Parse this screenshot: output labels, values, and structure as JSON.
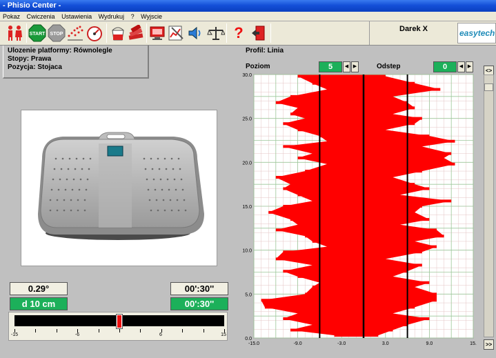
{
  "window": {
    "title": "- Phisio Center -"
  },
  "menu": [
    "Pokaz",
    "Cwiczenia",
    "Ustawienia",
    "Wydrukuj",
    "?",
    "Wyjscie"
  ],
  "toolbar": {
    "buttons": [
      {
        "name": "patients-icon"
      },
      {
        "name": "start-icon",
        "label": "START"
      },
      {
        "name": "stop-icon",
        "label": "STOP"
      },
      {
        "name": "sparkle-icon"
      },
      {
        "name": "gauge-icon"
      },
      {
        "name": "bucket-icon"
      },
      {
        "name": "books-icon"
      },
      {
        "name": "monitor-icon"
      },
      {
        "name": "chart-edit-icon"
      },
      {
        "name": "speaker-icon"
      },
      {
        "name": "balance-icon"
      },
      {
        "name": "help-icon",
        "label": "?"
      },
      {
        "name": "exit-icon"
      }
    ],
    "user": "Darek X",
    "logo": "easytech"
  },
  "info": {
    "line1": "Ulozenie platformy: Równolegle",
    "line2": "Stopy: Prawa",
    "line3": "Pozycja: Stojaca"
  },
  "readouts": {
    "angle": "0.29°",
    "time1": "00':30''",
    "distance": "d 10 cm",
    "time2": "00':30''"
  },
  "slider": {
    "min": -15,
    "max": 15,
    "value": 0,
    "tick_labels": [
      "-15",
      "-6",
      "6",
      "15"
    ]
  },
  "profile": {
    "label": "Profil: Linia",
    "poziom_label": "Poziom",
    "poziom_value": "5",
    "odstep_label": "Odstep",
    "odstep_value": "0"
  },
  "side_buttons": {
    "top": "<>",
    "bottom": ">>"
  },
  "colors": {
    "trace": "#ff0000",
    "green": "#1cb05a",
    "grid": "#b9dcb4"
  },
  "chart_data": {
    "type": "area",
    "x_ticks": [
      "-15.0",
      "-9.0",
      "-3.0",
      "3.0",
      "9.0",
      "15."
    ],
    "y_ticks": [
      "0.0",
      "5.0",
      "10.0",
      "15.0",
      "20.0",
      "25.0",
      "30.0"
    ],
    "xlim": [
      -15,
      15
    ],
    "ylim": [
      0,
      30
    ],
    "center_line": 0,
    "guide_lines": [
      -6,
      6
    ],
    "trace": [
      {
        "y": 29.8,
        "left": -9,
        "right": 3
      },
      {
        "y": 29.0,
        "left": -7,
        "right": 7
      },
      {
        "y": 28.3,
        "left": -5,
        "right": 10.5
      },
      {
        "y": 27.5,
        "left": -10,
        "right": 4
      },
      {
        "y": 26.8,
        "left": -12,
        "right": 6
      },
      {
        "y": 26.2,
        "left": -9,
        "right": 7
      },
      {
        "y": 25.5,
        "left": -10,
        "right": 4
      },
      {
        "y": 25.0,
        "left": -8,
        "right": 8
      },
      {
        "y": 24.4,
        "left": -11,
        "right": 7
      },
      {
        "y": 23.7,
        "left": -9,
        "right": 3
      },
      {
        "y": 23.0,
        "left": -6,
        "right": 9
      },
      {
        "y": 22.4,
        "left": -5,
        "right": 12.5
      },
      {
        "y": 21.8,
        "left": -11,
        "right": 8
      },
      {
        "y": 21.0,
        "left": -7,
        "right": 12
      },
      {
        "y": 20.5,
        "left": -9,
        "right": 11
      },
      {
        "y": 19.8,
        "left": -5,
        "right": 12.5
      },
      {
        "y": 19.0,
        "left": -8,
        "right": 8
      },
      {
        "y": 18.3,
        "left": -12,
        "right": 4
      },
      {
        "y": 17.5,
        "left": -10,
        "right": 7
      },
      {
        "y": 17.0,
        "left": -11,
        "right": 9
      },
      {
        "y": 16.3,
        "left": -9,
        "right": 5
      },
      {
        "y": 15.6,
        "left": -7,
        "right": 12
      },
      {
        "y": 15.0,
        "left": -11,
        "right": 8
      },
      {
        "y": 14.3,
        "left": -13,
        "right": 7
      },
      {
        "y": 13.5,
        "left": -10,
        "right": 9
      },
      {
        "y": 12.9,
        "left": -9,
        "right": 5
      },
      {
        "y": 12.3,
        "left": -12,
        "right": 10
      },
      {
        "y": 11.6,
        "left": -8,
        "right": 11
      },
      {
        "y": 11.0,
        "left": -7,
        "right": 7
      },
      {
        "y": 10.4,
        "left": -5,
        "right": 10
      },
      {
        "y": 9.8,
        "left": -11,
        "right": 8
      },
      {
        "y": 9.0,
        "left": -12,
        "right": 3
      },
      {
        "y": 8.3,
        "left": -7,
        "right": 8
      },
      {
        "y": 7.6,
        "left": -11,
        "right": 6
      },
      {
        "y": 7.0,
        "left": -9,
        "right": 4
      },
      {
        "y": 6.3,
        "left": -6,
        "right": 9
      },
      {
        "y": 5.8,
        "left": -7,
        "right": 7
      },
      {
        "y": 5.0,
        "left": -8,
        "right": 10
      },
      {
        "y": 4.3,
        "left": -14,
        "right": 10
      },
      {
        "y": 3.5,
        "left": -13.5,
        "right": 7
      },
      {
        "y": 2.8,
        "left": -9,
        "right": 4
      },
      {
        "y": 2.2,
        "left": -11,
        "right": 9
      },
      {
        "y": 1.5,
        "left": -7,
        "right": 6
      },
      {
        "y": 0.9,
        "left": -10,
        "right": 4
      },
      {
        "y": 0.3,
        "left": -4,
        "right": 2
      }
    ]
  }
}
